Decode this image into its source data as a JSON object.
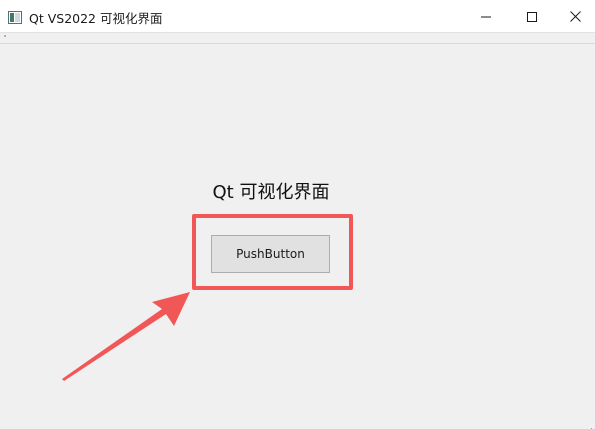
{
  "window": {
    "title": "Qt VS2022 可视化界面",
    "icon": "qt-app-window-icon",
    "controls": [
      "minimize-icon",
      "maximize-icon",
      "close-icon"
    ]
  },
  "main": {
    "heading": "Qt 可视化界面",
    "button_label": "PushButton"
  },
  "annotation": {
    "highlight_color": "#f25757",
    "arrow_color": "#f25757"
  }
}
